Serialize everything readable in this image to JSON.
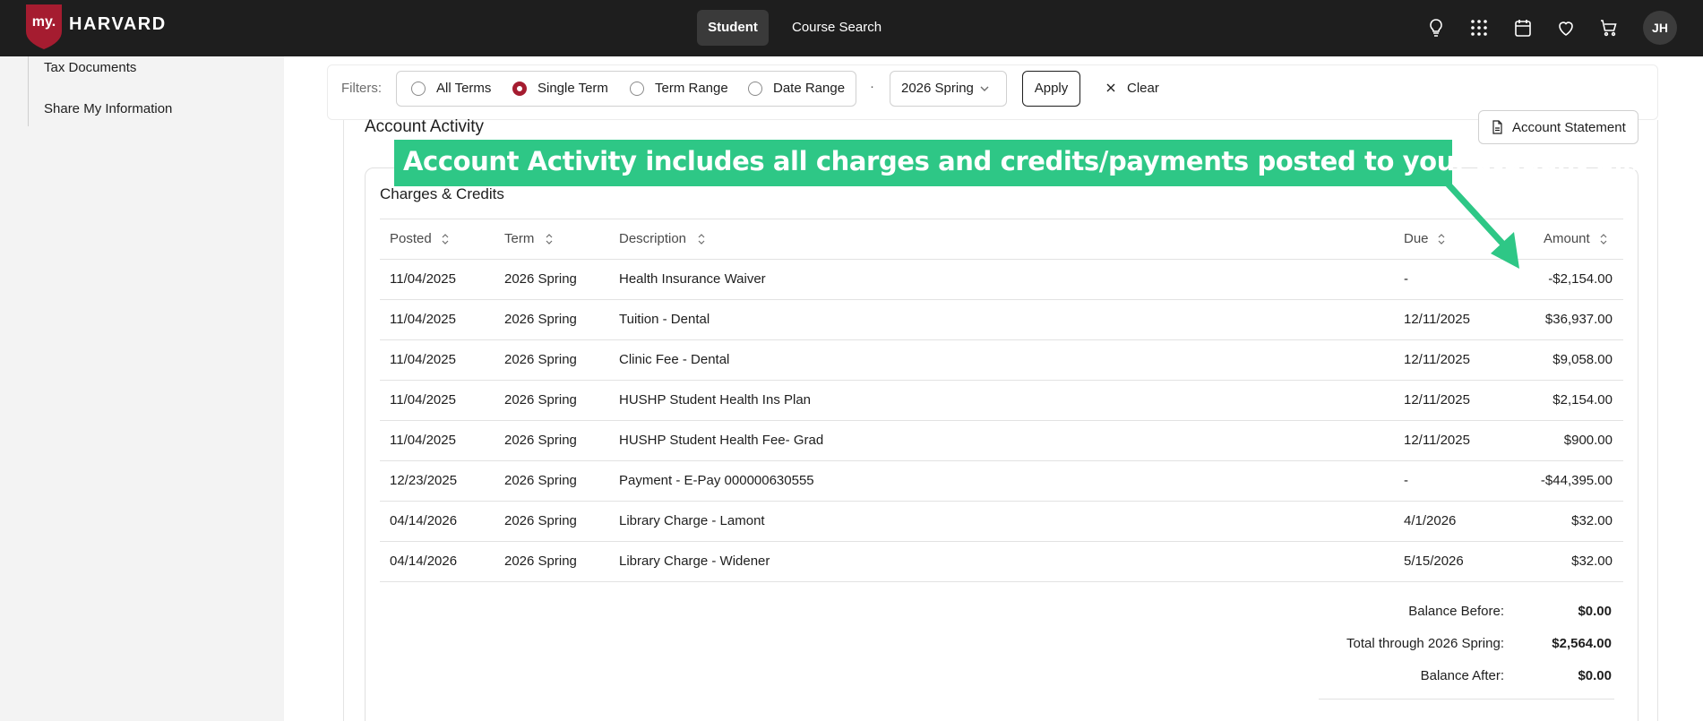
{
  "header": {
    "logo_prefix": "my.",
    "logo_word": "HARVARD",
    "nav": [
      {
        "label": "Student"
      },
      {
        "label": "Course Search"
      }
    ],
    "icons": [
      "lightbulb-icon",
      "apps-grid-icon",
      "calendar-icon",
      "heart-icon",
      "cart-icon"
    ],
    "avatar_initials": "JH"
  },
  "sidebar": {
    "items": [
      {
        "label": "Tax Documents"
      },
      {
        "label": "Share My Information"
      }
    ]
  },
  "filters": {
    "label": "Filters:",
    "options": [
      {
        "label": "All Terms",
        "selected": false
      },
      {
        "label": "Single Term",
        "selected": true
      },
      {
        "label": "Term Range",
        "selected": false
      },
      {
        "label": "Date Range",
        "selected": false
      }
    ],
    "separator": "·",
    "term_value": "2026 Spring",
    "apply_label": "Apply",
    "clear_label": "Clear"
  },
  "account": {
    "title": "Account Activity",
    "statement_button": "Account Statement",
    "card_title": "Charges & Credits",
    "columns": [
      "Posted",
      "Term",
      "Description",
      "Due",
      "Amount"
    ],
    "rows": [
      {
        "posted": "11/04/2025",
        "term": "2026 Spring",
        "description": "Health Insurance Waiver",
        "due": "-",
        "amount": "-$2,154.00"
      },
      {
        "posted": "11/04/2025",
        "term": "2026 Spring",
        "description": "Tuition - Dental",
        "due": "12/11/2025",
        "amount": "$36,937.00"
      },
      {
        "posted": "11/04/2025",
        "term": "2026 Spring",
        "description": "Clinic Fee - Dental",
        "due": "12/11/2025",
        "amount": "$9,058.00"
      },
      {
        "posted": "11/04/2025",
        "term": "2026 Spring",
        "description": "HUSHP Student Health Ins Plan",
        "due": "12/11/2025",
        "amount": "$2,154.00"
      },
      {
        "posted": "11/04/2025",
        "term": "2026 Spring",
        "description": "HUSHP Student Health Fee- Grad",
        "due": "12/11/2025",
        "amount": "$900.00"
      },
      {
        "posted": "12/23/2025",
        "term": "2026 Spring",
        "description": "Payment - E-Pay 000000630555",
        "due": "-",
        "amount": "-$44,395.00"
      },
      {
        "posted": "04/14/2026",
        "term": "2026 Spring",
        "description": "Library Charge - Lamont",
        "due": "4/1/2026",
        "amount": "$32.00"
      },
      {
        "posted": "04/14/2026",
        "term": "2026 Spring",
        "description": "Library Charge - Widener",
        "due": "5/15/2026",
        "amount": "$32.00"
      }
    ],
    "totals": [
      {
        "label": "Balance Before:",
        "value": "$0.00"
      },
      {
        "label": "Total through 2026 Spring:",
        "value": "$2,564.00"
      },
      {
        "label": "Balance After:",
        "value": "$0.00"
      }
    ]
  },
  "callout": {
    "text": "Account Activity includes all charges and credits/payments posted to your student bill.",
    "color": "#2ec786"
  },
  "colors": {
    "brand": "#a51c30",
    "topbar": "#1e1e1e"
  }
}
